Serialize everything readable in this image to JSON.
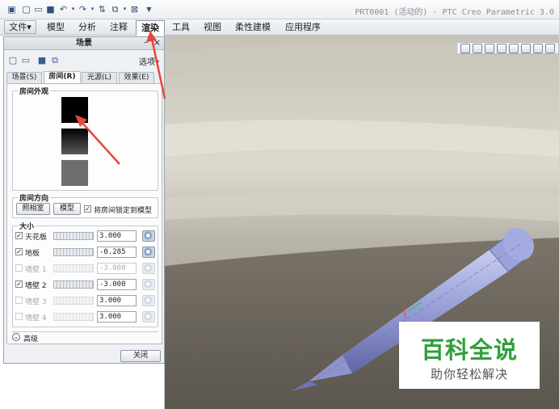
{
  "window": {
    "title": "PRT0001 (活动的) - PTC Creo Parametric 3.0"
  },
  "ribbon": {
    "tabs": [
      {
        "label": "文件"
      },
      {
        "label": "模型"
      },
      {
        "label": "分析"
      },
      {
        "label": "注释"
      },
      {
        "label": "渲染"
      },
      {
        "label": "工具"
      },
      {
        "label": "视图"
      },
      {
        "label": "柔性建模"
      },
      {
        "label": "应用程序"
      }
    ],
    "active_tab": "渲染"
  },
  "scene_dialog": {
    "title": "场景",
    "options_label": "选项",
    "tabs": [
      {
        "label": "场景(S)"
      },
      {
        "label": "房间(R)"
      },
      {
        "label": "光源(L)"
      },
      {
        "label": "效果(E)"
      }
    ],
    "active_tab": "房间(R)",
    "room_appearance": {
      "label": "房间外观",
      "swatch_colors": [
        "#000000",
        "#1a1a1a",
        "#6e6e6e"
      ]
    },
    "room_orientation": {
      "label": "房间方向",
      "studio_button": "照相室",
      "model_button": "模型",
      "lock_label": "将房间锁定到模型",
      "lock_checked": true
    },
    "size": {
      "label": "大小",
      "rows": [
        {
          "label": "天花板",
          "value": "3.000",
          "checked": true,
          "enabled": true
        },
        {
          "label": "地板",
          "value": "-0.285",
          "checked": true,
          "enabled": true
        },
        {
          "label": "墙壁 1",
          "value": "-3.000",
          "checked": false,
          "enabled": false
        },
        {
          "label": "墙壁 2",
          "value": "-3.000",
          "checked": true,
          "enabled": true
        },
        {
          "label": "墙壁 3",
          "value": "3.000",
          "checked": false,
          "enabled": false
        },
        {
          "label": "墙壁 4",
          "value": "3.000",
          "checked": false,
          "enabled": false
        }
      ]
    },
    "advanced_label": "高级",
    "close_button": "关闭"
  },
  "watermark": {
    "main": "百科全说",
    "sub": "助你轻松解决"
  },
  "colors": {
    "annotation_arrow": "#e8453c",
    "model": "#9aa0d8",
    "watermark_green": "#2f9f3c"
  }
}
